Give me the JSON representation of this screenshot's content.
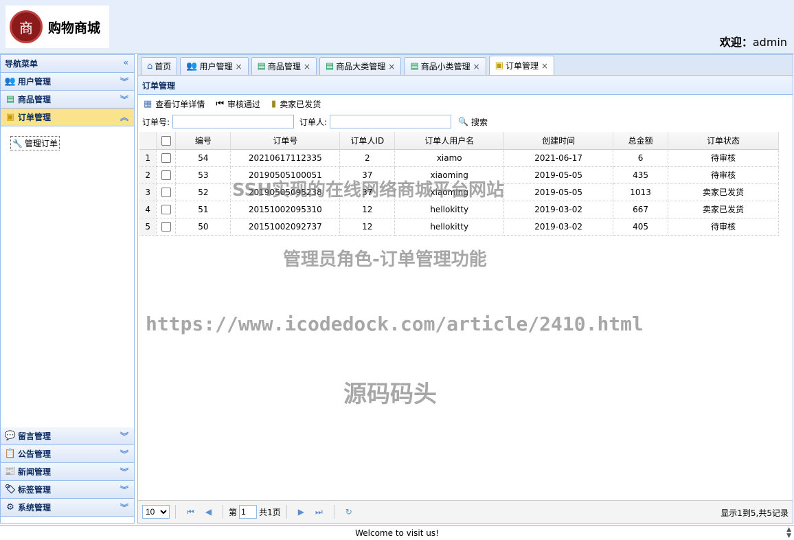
{
  "header": {
    "logo_glyph": "商",
    "logo_text": "购物商城",
    "welcome_label": "欢迎：",
    "welcome_user": "admin"
  },
  "nav": {
    "title": "导航菜单",
    "collapse_glyph": "«",
    "top_items": [
      {
        "label": "用户管理",
        "icon": "users-icon"
      },
      {
        "label": "商品管理",
        "icon": "list-icon"
      },
      {
        "label": "订单管理",
        "icon": "order-icon",
        "active": true
      }
    ],
    "sub_items": [
      {
        "label": "管理订单",
        "icon": "tools-icon"
      }
    ],
    "bottom_items": [
      {
        "label": "留言管理",
        "icon": "comment-icon"
      },
      {
        "label": "公告管理",
        "icon": "notice-icon"
      },
      {
        "label": "新闻管理",
        "icon": "news-icon"
      },
      {
        "label": "标签管理",
        "icon": "tag-icon"
      },
      {
        "label": "系统管理",
        "icon": "gear-icon"
      }
    ]
  },
  "tabs": [
    {
      "label": "首页",
      "icon": "home-icon",
      "closable": false
    },
    {
      "label": "用户管理",
      "icon": "users-icon",
      "closable": true
    },
    {
      "label": "商品管理",
      "icon": "list-icon",
      "closable": true
    },
    {
      "label": "商品大类管理",
      "icon": "list-icon",
      "closable": true
    },
    {
      "label": "商品小类管理",
      "icon": "list-icon",
      "closable": true
    },
    {
      "label": "订单管理",
      "icon": "order-icon",
      "closable": true,
      "active": true
    }
  ],
  "panel": {
    "title": "订单管理",
    "toolbar": {
      "view_detail": "查看订单详情",
      "approve": "审核通过",
      "shipped": "卖家已发货"
    },
    "search": {
      "order_no_label": "订单号:",
      "orderer_label": "订单人:",
      "order_no_value": "",
      "orderer_value": "",
      "search_label": "搜索"
    }
  },
  "grid": {
    "columns": [
      "编号",
      "订单号",
      "订单人ID",
      "订单人用户名",
      "创建时间",
      "总金额",
      "订单状态"
    ],
    "rows": [
      {
        "rn": "1",
        "id": "54",
        "order_no": "20210617112335",
        "user_id": "2",
        "username": "xiamo",
        "created": "2021-06-17",
        "total": "6",
        "status": "待审核"
      },
      {
        "rn": "2",
        "id": "53",
        "order_no": "20190505100051",
        "user_id": "37",
        "username": "xiaoming",
        "created": "2019-05-05",
        "total": "435",
        "status": "待审核"
      },
      {
        "rn": "3",
        "id": "52",
        "order_no": "20190505095238",
        "user_id": "37",
        "username": "xiaoming",
        "created": "2019-05-05",
        "total": "1013",
        "status": "卖家已发货"
      },
      {
        "rn": "4",
        "id": "51",
        "order_no": "20151002095310",
        "user_id": "12",
        "username": "hellokitty",
        "created": "2019-03-02",
        "total": "667",
        "status": "卖家已发货"
      },
      {
        "rn": "5",
        "id": "50",
        "order_no": "20151002092737",
        "user_id": "12",
        "username": "hellokitty",
        "created": "2019-03-02",
        "total": "405",
        "status": "待审核"
      }
    ]
  },
  "pager": {
    "page_size": "10",
    "page_prefix": "第",
    "page_value": "1",
    "page_suffix": "共1页",
    "info": "显示1到5,共5记录"
  },
  "footer": {
    "text": "Welcome to visit us!"
  },
  "watermarks": {
    "line1": "SSH实现的在线网络商城平台网站",
    "line2": "管理员角色-订单管理功能",
    "line3": "https://www.icodedock.com/article/2410.html",
    "line4": "源码码头"
  }
}
